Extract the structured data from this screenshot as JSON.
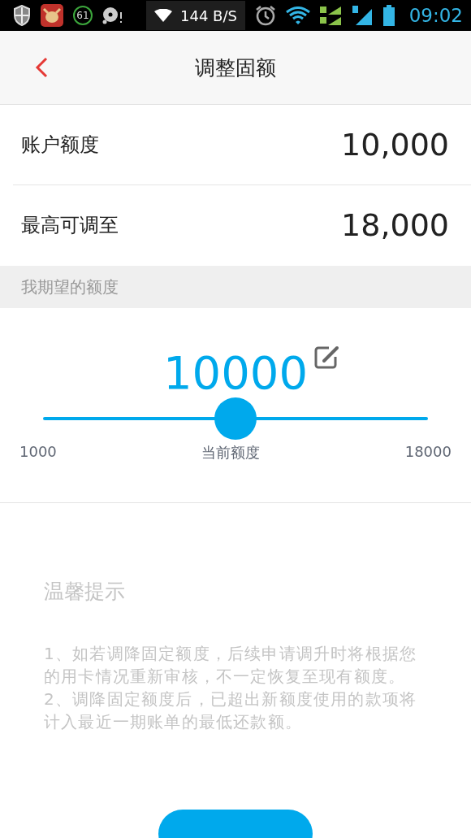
{
  "status_bar": {
    "notification_count": "61",
    "network_speed": "144 B/S",
    "time": "09:02"
  },
  "header": {
    "title": "调整固额"
  },
  "info_rows": [
    {
      "label": "账户额度",
      "value": "10,000"
    },
    {
      "label": "最高可调至",
      "value": "18,000"
    }
  ],
  "section_header": "我期望的额度",
  "slider": {
    "value": "10000",
    "level": 0.5,
    "min_label": "1000",
    "center_label": "当前额度",
    "max_label": "18000"
  },
  "tips": {
    "title": "温馨提示",
    "items": [
      "1、如若调降固定额度，后续申请调升时将根据您的用卡情况重新审核，不一定恢复至现有额度。",
      "2、调降固定额度后，已超出新额度使用的款项将计入最近一期账单的最低还款额。"
    ]
  }
}
